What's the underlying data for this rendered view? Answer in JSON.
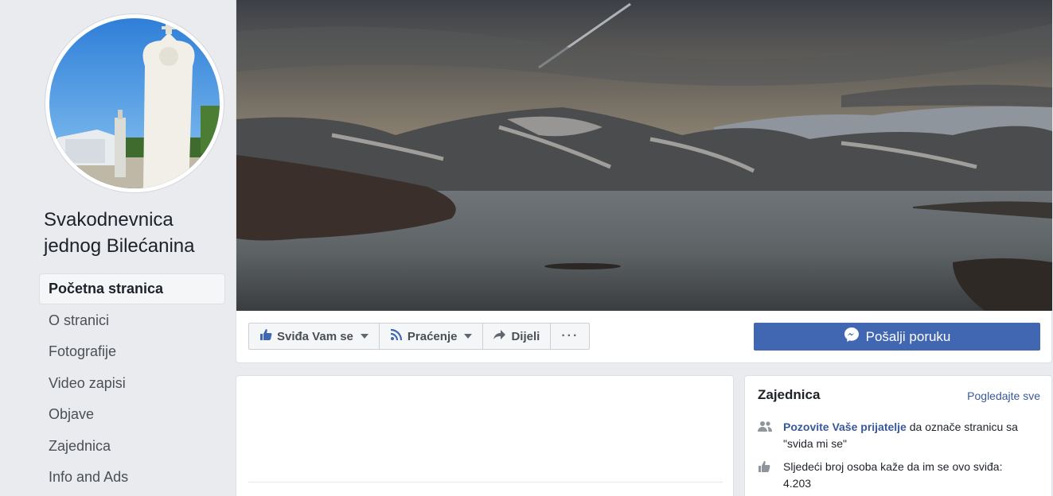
{
  "sidebar": {
    "page_name": "Svakodnevnica jednog Bilećanina",
    "nav": [
      {
        "label": "Početna stranica"
      },
      {
        "label": "O stranici"
      },
      {
        "label": "Fotografije"
      },
      {
        "label": "Video zapisi"
      },
      {
        "label": "Objave"
      },
      {
        "label": "Zajednica"
      },
      {
        "label": "Info and Ads"
      }
    ]
  },
  "actions": {
    "like_label": "Sviđa Vam se",
    "follow_label": "Praćenje",
    "share_label": "Dijeli",
    "more_label": "···",
    "send_message_label": "Pošalji poruku"
  },
  "community": {
    "title": "Zajednica",
    "see_all": "Pogledajte sve",
    "invite_link": "Pozovite Vaše prijatelje",
    "invite_text": " da označe stranicu sa \"svida mi se\"",
    "likes_text": "Sljedeći broj osoba kaže da im se ovo sviđa:",
    "likes_count": "4.203"
  },
  "colors": {
    "brand_blue": "#4267b2",
    "link_blue": "#385898",
    "background": "#e9ebee"
  }
}
